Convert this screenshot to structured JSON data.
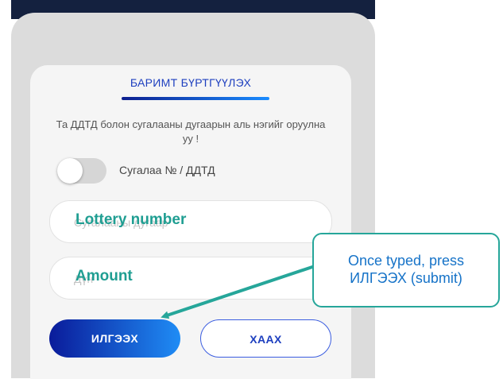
{
  "modal": {
    "title": "БАРИМТ БҮРТГҮҮЛЭХ",
    "instruction": "Та ДДТД болон сугалааны дугаарын аль нэгийг оруулна уу !",
    "toggle_label": "Сугалаа № / ДДТД",
    "toggle_on": false,
    "lottery_placeholder": "Сугалааны дугаар",
    "amount_placeholder": "Дүн",
    "submit_label": "ИЛГЭЭХ",
    "close_label": "ХААХ"
  },
  "annotations": {
    "lottery_overlay": "Lottery number",
    "amount_overlay": "Amount",
    "callout_text_line1": "Once typed, press",
    "callout_text_line2": "ИЛГЭЭХ (submit)"
  },
  "colors": {
    "accent_blue": "#1d3fbf",
    "annotation_teal": "#1f9e92",
    "callout_text": "#1673c8",
    "header_dark": "#14213f"
  }
}
